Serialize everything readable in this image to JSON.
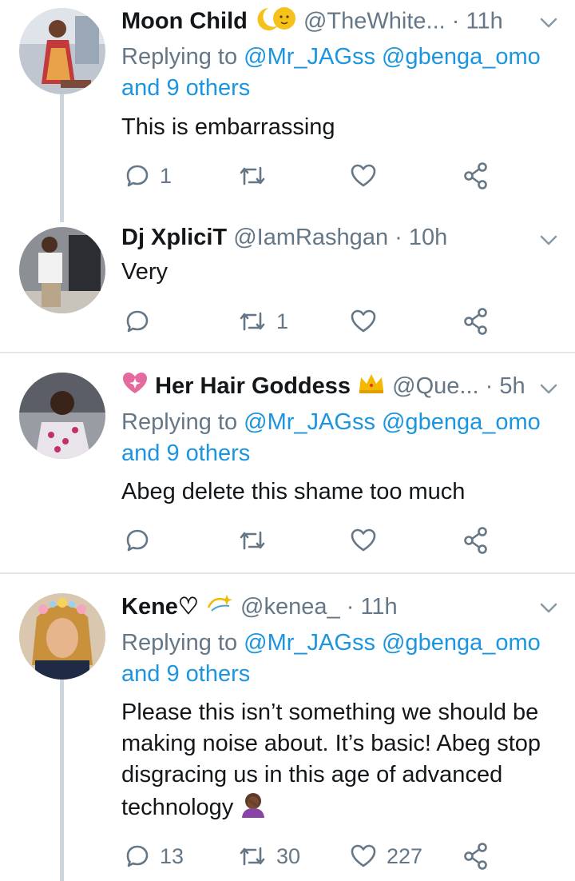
{
  "replies": [
    {
      "name": "Moon Child",
      "handle": "@TheWhite...",
      "dot": "·",
      "time": "11h",
      "replying_prefix": "Replying to",
      "mentions": "@Mr_JAGss @gbenga_omo",
      "others": "and 9 others",
      "text": "This is embarrassing",
      "reply_count": "1",
      "retweet_count": "",
      "like_count": ""
    },
    {
      "name": "Dj XpliciT",
      "handle": "@IamRashgan",
      "dot": "·",
      "time": "10h",
      "text": "Very",
      "reply_count": "",
      "retweet_count": "1",
      "like_count": ""
    },
    {
      "name": "Her Hair Goddess",
      "handle": "@Que...",
      "dot": "·",
      "time": "5h",
      "replying_prefix": "Replying to",
      "mentions": "@Mr_JAGss @gbenga_omo",
      "others": "and 9 others",
      "text": "Abeg delete this shame too much",
      "reply_count": "",
      "retweet_count": "",
      "like_count": ""
    },
    {
      "name": "Kene♡",
      "handle": "@kenea_",
      "dot": "·",
      "time": "11h",
      "replying_prefix": "Replying to",
      "mentions": "@Mr_JAGss @gbenga_omo",
      "others": "and 9 others",
      "text_lines": [
        "Please this isn’t something we should be",
        "making noise about. It’s basic! Abeg stop",
        "disgracing us in this age of advanced",
        "technology"
      ],
      "reply_count": "13",
      "retweet_count": "30",
      "like_count": "227"
    }
  ],
  "icons": [
    "reply-icon",
    "retweet-icon",
    "like-icon",
    "share-icon",
    "chevron-down-icon",
    "crescent-moon-emoji",
    "sparkling-heart-emoji",
    "crown-emoji",
    "dizzy-emoji",
    "facepalm-emoji"
  ],
  "colors": {
    "link": "#1b95e0",
    "muted": "#657786",
    "text": "#14171a",
    "divider": "#e1e8ed",
    "thread_line": "#cdd6dd"
  }
}
